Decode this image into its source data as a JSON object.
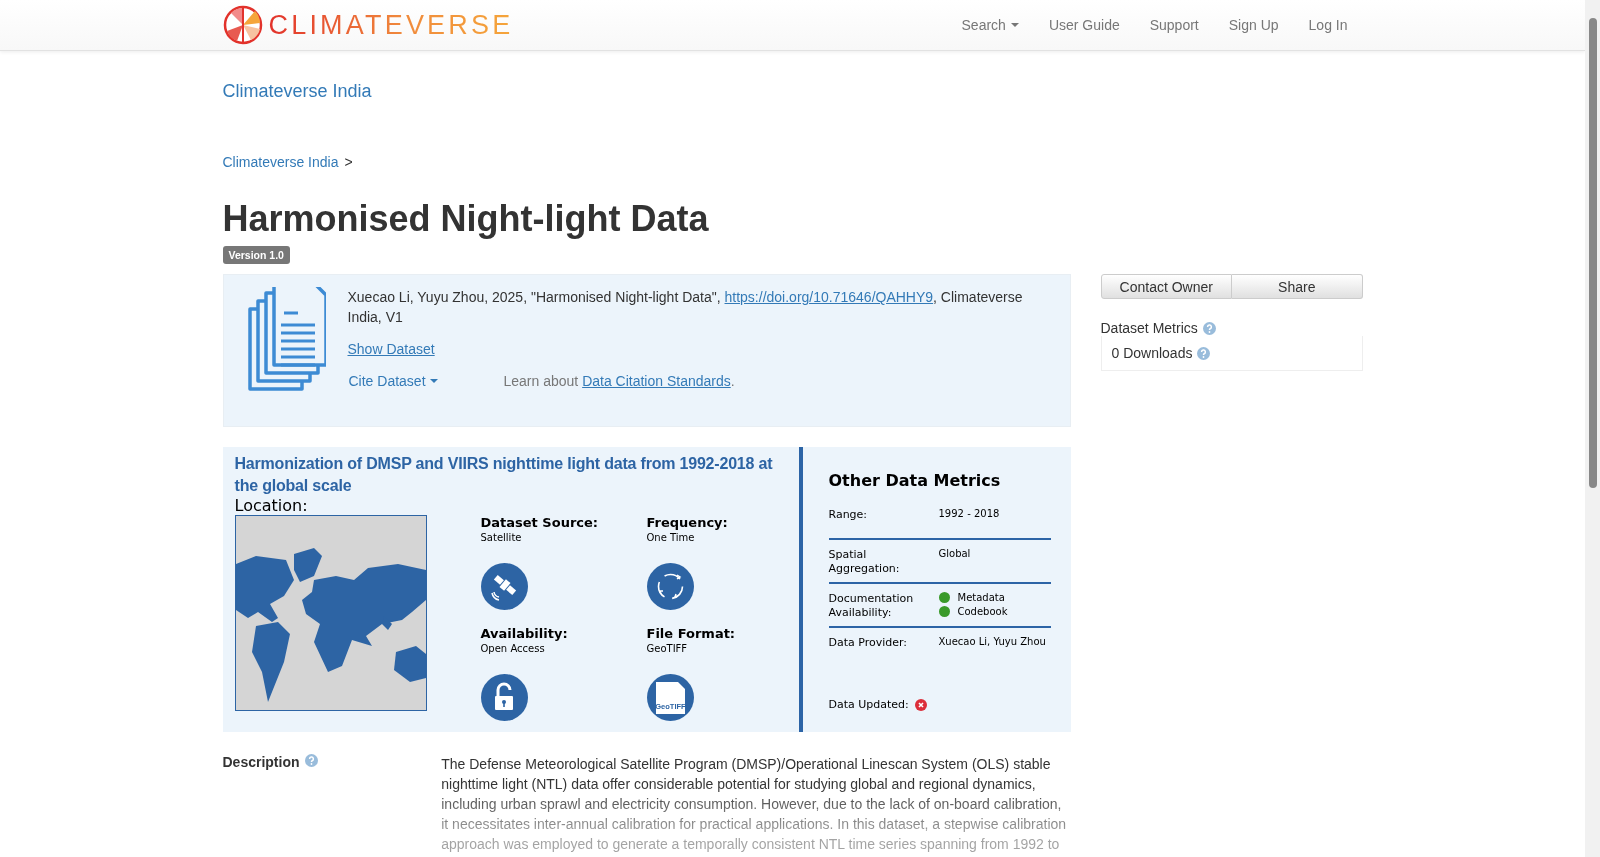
{
  "navbar": {
    "brand": "CLIMATEVERSE",
    "links": [
      {
        "label": "Search",
        "kind": "dropdown"
      },
      {
        "label": "User Guide",
        "kind": "link"
      },
      {
        "label": "Support",
        "kind": "link"
      },
      {
        "label": "Sign Up",
        "kind": "link"
      },
      {
        "label": "Log In",
        "kind": "link"
      }
    ]
  },
  "collection_title": "Climateverse India",
  "breadcrumb": {
    "items": [
      "Climateverse India"
    ],
    "separator": ">"
  },
  "title": "Harmonised Night-light Data",
  "version": "Version 1.0",
  "citation": {
    "text_before": "Xuecao Li, Yuyu Zhou, 2025, \"Harmonised Night-light Data\", ",
    "doi": "https://doi.org/10.71646/QAHHY9",
    "text_after": ", Climateverse India, V1",
    "show_dataset": "Show Dataset",
    "cite_dataset": "Cite Dataset",
    "learn_prefix": "Learn about ",
    "learn_link": "Data Citation Standards",
    "learn_suffix": "."
  },
  "infographic": {
    "title": "Harmonization of DMSP and VIIRS nighttime light data from 1992-2018 at the global scale",
    "location_label": "Location:",
    "facts": [
      {
        "label": "Dataset Source:",
        "value": "Satellite",
        "kind": "satellite"
      },
      {
        "label": "Frequency:",
        "value": "One Time",
        "kind": "cycle"
      },
      {
        "label": "Availability:",
        "value": "Open Access",
        "kind": "lock"
      },
      {
        "label": "File Format:",
        "value": "GeoTIFF",
        "kind": "file",
        "icon_text": "GeoTIFF"
      }
    ],
    "metrics_title": "Other Data Metrics",
    "metrics": [
      {
        "label": "Range:",
        "kind": "text",
        "value": "1992 - 2018"
      },
      {
        "label": "Spatial Aggregation:",
        "kind": "text",
        "value": "Global"
      },
      {
        "label": "Documentation Availability:",
        "kind": "docs",
        "items": [
          {
            "label": "Metadata",
            "available": true
          },
          {
            "label": "Codebook",
            "available": true
          }
        ]
      },
      {
        "label": "Data Provider:",
        "kind": "text",
        "value": "Xuecao Li, Yuyu Zhou"
      }
    ],
    "updated": {
      "label": "Data Updated:",
      "available": false
    }
  },
  "sidebar": {
    "buttons": [
      "Contact Owner",
      "Share"
    ],
    "metrics_title": "Dataset Metrics",
    "downloads": "0 Downloads"
  },
  "description": {
    "label": "Description",
    "text": "The Defense Meteorological Satellite Program (DMSP)/Operational Linescan System (OLS) stable nighttime light (NTL) data offer considerable potential for studying global and regional dynamics, including urban sprawl and electricity consumption. However, due to the lack of on-board calibration, it necessitates inter-annual calibration for practical applications. In this dataset, a stepwise calibration approach was employed to generate a temporally consistent NTL time series spanning from 1992 to"
  }
}
